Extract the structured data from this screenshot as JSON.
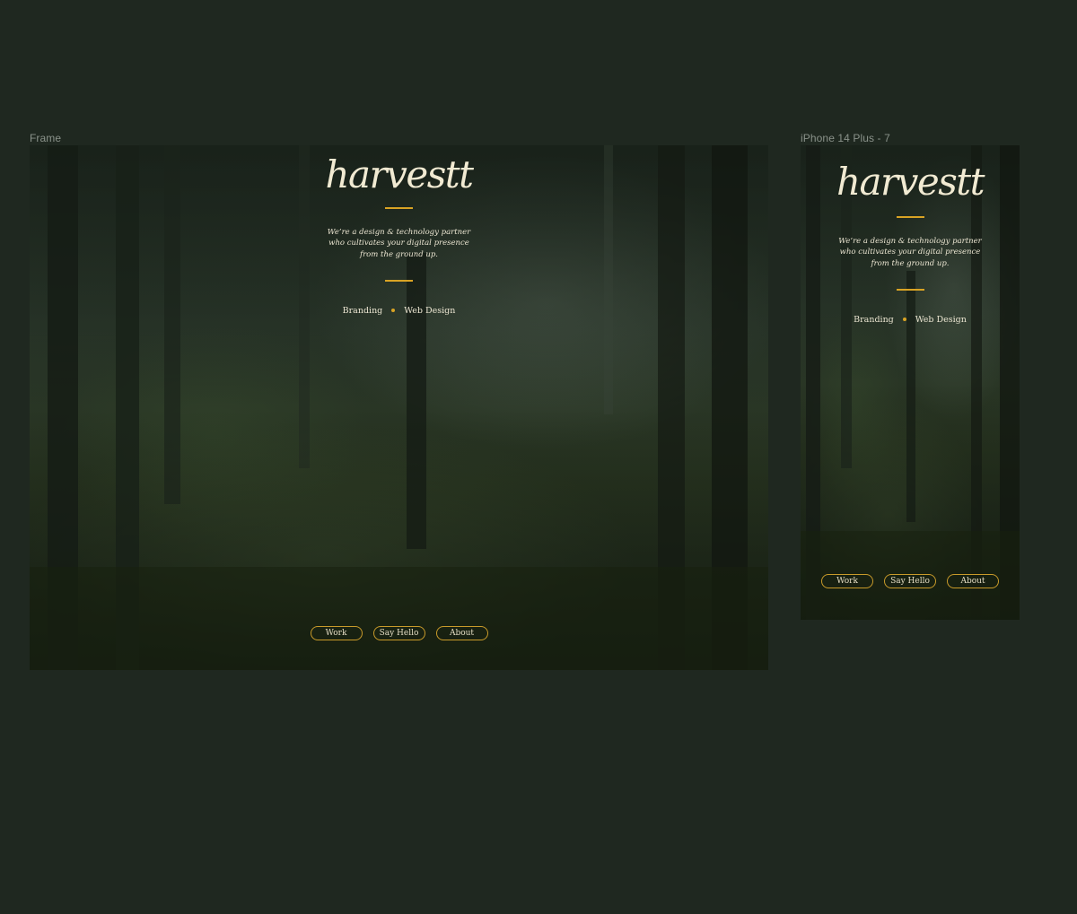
{
  "canvas": {
    "frames": [
      {
        "label": "Frame",
        "logo": "harvestt",
        "tagline": [
          "We’re a design & technology partner",
          "who cultivates your digital presence",
          "from the ground up."
        ],
        "services": [
          "Branding",
          "Web Design"
        ],
        "nav": [
          "Work",
          "Say Hello",
          "About"
        ]
      },
      {
        "label": "iPhone 14 Plus - 7",
        "logo": "harvestt",
        "tagline": [
          "We’re a design & technology partner",
          "who cultivates your digital presence",
          "from the ground up."
        ],
        "services": [
          "Branding",
          "Web Design"
        ],
        "nav": [
          "Work",
          "Say Hello",
          "About"
        ]
      }
    ]
  },
  "colors": {
    "canvas_bg": "#1f2820",
    "accent": "#d9a324",
    "text": "#ece6d2"
  }
}
